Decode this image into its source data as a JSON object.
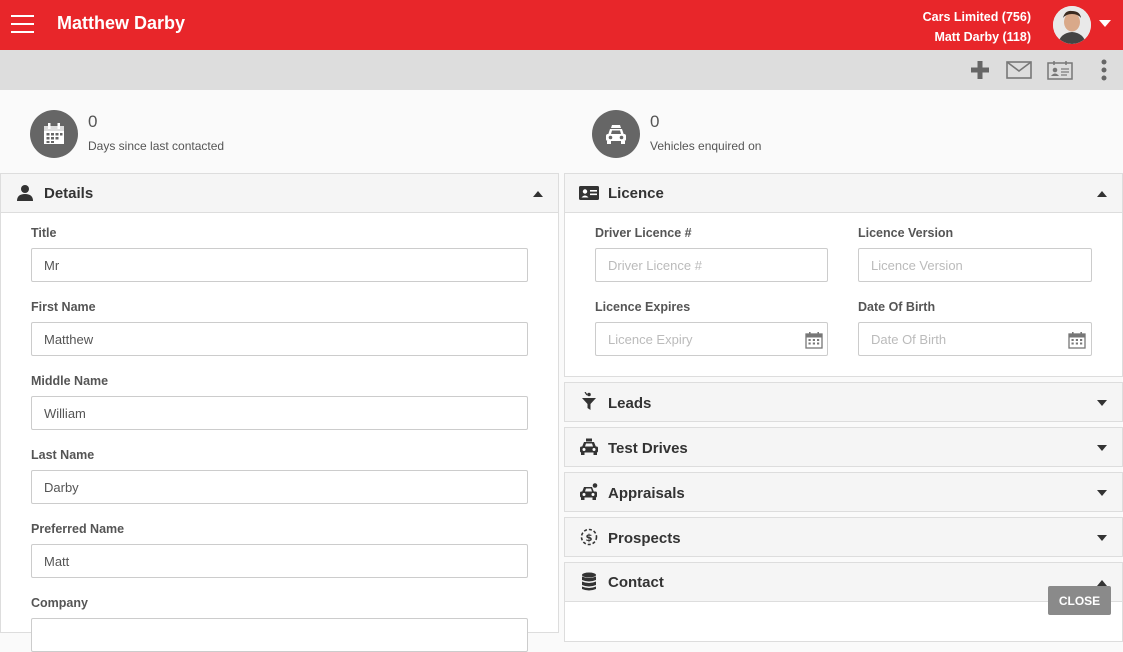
{
  "header": {
    "title": "Matthew Darby",
    "account_line1": "Cars Limited (756)",
    "account_line2": "Matt Darby (118)",
    "accent": "#e8262a"
  },
  "toolbar": {
    "icons": [
      "plus-icon",
      "envelope-icon",
      "contact-card-icon",
      "more-vertical-icon"
    ]
  },
  "stats": [
    {
      "value": "0",
      "label": "Days since last contacted",
      "icon": "calendar-icon"
    },
    {
      "value": "0",
      "label": "Vehicles enquired on",
      "icon": "car-icon"
    }
  ],
  "details": {
    "title": "Details",
    "fields": [
      {
        "label": "Title",
        "value": "Mr"
      },
      {
        "label": "First Name",
        "value": "Matthew"
      },
      {
        "label": "Middle Name",
        "value": "William"
      },
      {
        "label": "Last Name",
        "value": "Darby"
      },
      {
        "label": "Preferred Name",
        "value": "Matt"
      },
      {
        "label": "Company",
        "value": ""
      }
    ]
  },
  "licence": {
    "title": "Licence",
    "fields": [
      {
        "label": "Driver Licence #",
        "placeholder": "Driver Licence #"
      },
      {
        "label": "Licence Version",
        "placeholder": "Licence Version"
      },
      {
        "label": "Licence Expires",
        "placeholder": "Licence Expiry"
      },
      {
        "label": "Date Of Birth",
        "placeholder": "Date Of Birth"
      }
    ]
  },
  "sections": [
    "Leads",
    "Test Drives",
    "Appraisals",
    "Prospects",
    "Contact"
  ],
  "close_label": "CLOSE"
}
